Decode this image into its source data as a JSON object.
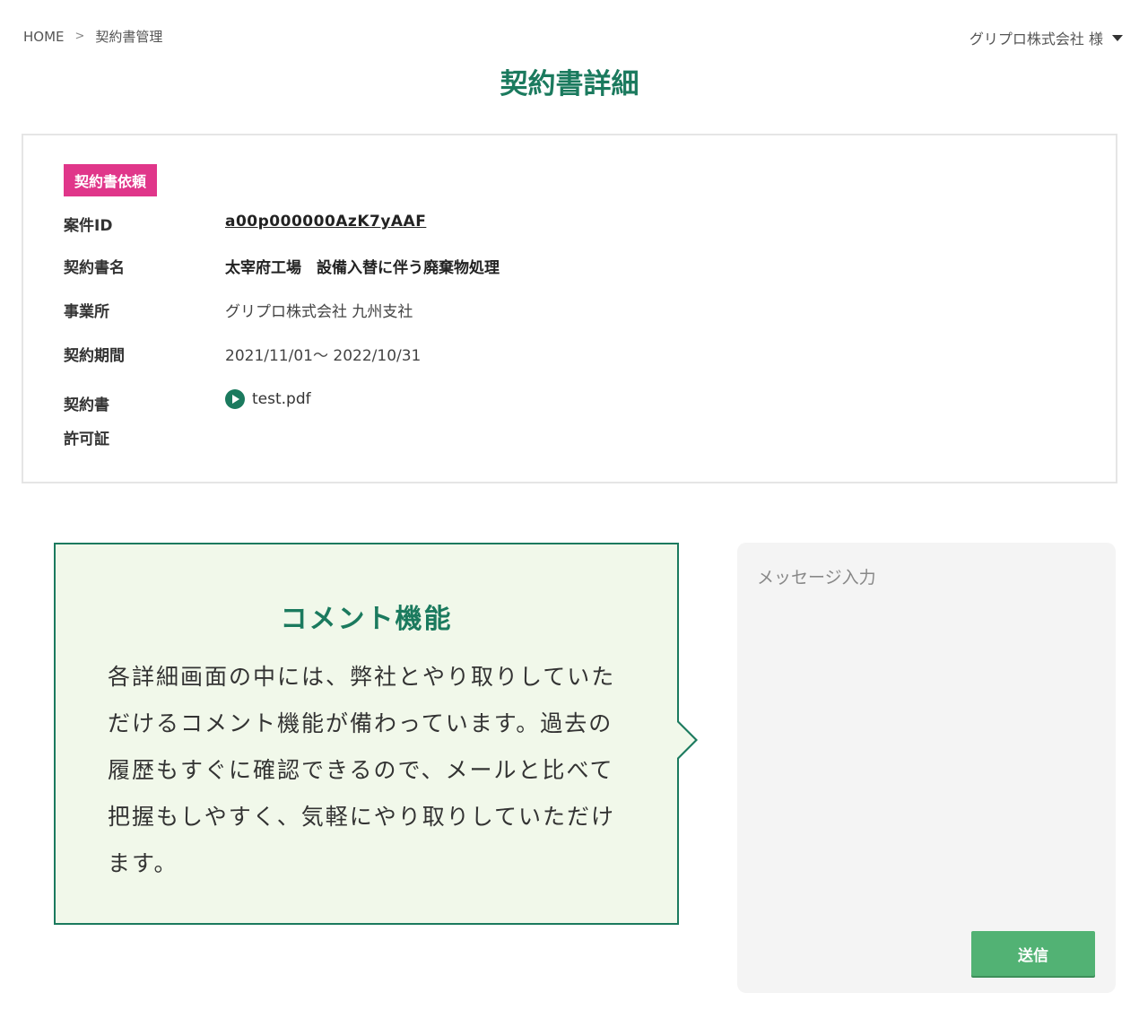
{
  "breadcrumb": {
    "home": "HOME",
    "separator": ">",
    "current": "契約書管理"
  },
  "user_menu": {
    "label": "グリプロ株式会社 様"
  },
  "page_title": "契約書詳細",
  "detail": {
    "badge": "契約書依頼",
    "rows": [
      {
        "label": "案件ID",
        "value": "a00p000000AzK7yAAF"
      },
      {
        "label": "契約書名",
        "value": "太宰府工場　設備入替に伴う廃棄物処理"
      },
      {
        "label": "事業所",
        "value": "グリプロ株式会社 九州支社"
      },
      {
        "label": "契約期間",
        "value": "2021/11/01～ 2022/10/31"
      },
      {
        "label": "契約書",
        "value": "test.pdf"
      },
      {
        "label": "許可証",
        "value": ""
      }
    ]
  },
  "callout": {
    "title": "コメント機能",
    "body": "各詳細画面の中には、弊社とやり取りしていただけるコメント機能が備わっています。過去の履歴もすぐに確認できるので、メールと比べて把握もしやすく、気軽にやり取りしていただけます。"
  },
  "message": {
    "placeholder": "メッセージ入力",
    "send_label": "送信"
  },
  "colors": {
    "accent": "#1b7a5e",
    "badge": "#e0368a",
    "callout_bg": "#f1f8ea",
    "send_button": "#52b274",
    "panel_bg": "#f4f4f4"
  },
  "icons": {
    "dropdown": "caret-down-icon",
    "file": "play-circle-icon"
  }
}
